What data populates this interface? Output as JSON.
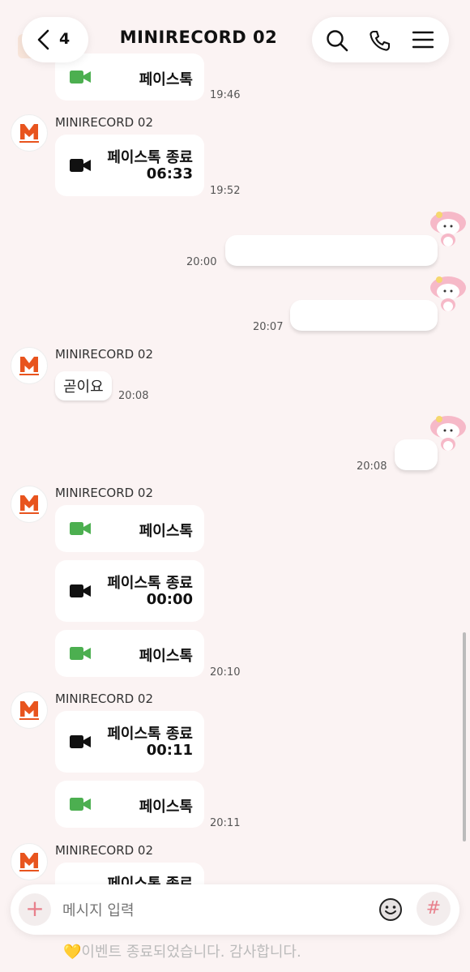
{
  "header": {
    "back_count": "4",
    "title": "MINIRECORD 02"
  },
  "sender_name": "MINIRECORD 02",
  "messages": {
    "m1": {
      "label": "페이스톡",
      "time": "19:46"
    },
    "m2": {
      "label": "페이스톡 종료",
      "duration": "06:33",
      "time": "19:52"
    },
    "o1": {
      "time": "20:00"
    },
    "o2": {
      "time": "20:07"
    },
    "m3": {
      "text": "곧이요",
      "time": "20:08"
    },
    "o3": {
      "time": "20:08"
    },
    "m4": {
      "label": "페이스톡"
    },
    "m5": {
      "label": "페이스톡 종료",
      "duration": "00:00"
    },
    "m6": {
      "label": "페이스톡",
      "time": "20:10"
    },
    "m7": {
      "label": "페이스톡 종료",
      "duration": "00:11"
    },
    "m8": {
      "label": "페이스톡",
      "time": "20:11"
    },
    "m9": {
      "label": "페이스톡 종료"
    }
  },
  "input": {
    "placeholder": "메시지 입력"
  },
  "notice": "💛이벤트 종료되었습니다. 감사합니다.",
  "colors": {
    "background": "#fbf3f3",
    "facetalk_green": "#4caf50",
    "accent_pink": "#e8808c",
    "avatar_orange": "#e8541e"
  }
}
